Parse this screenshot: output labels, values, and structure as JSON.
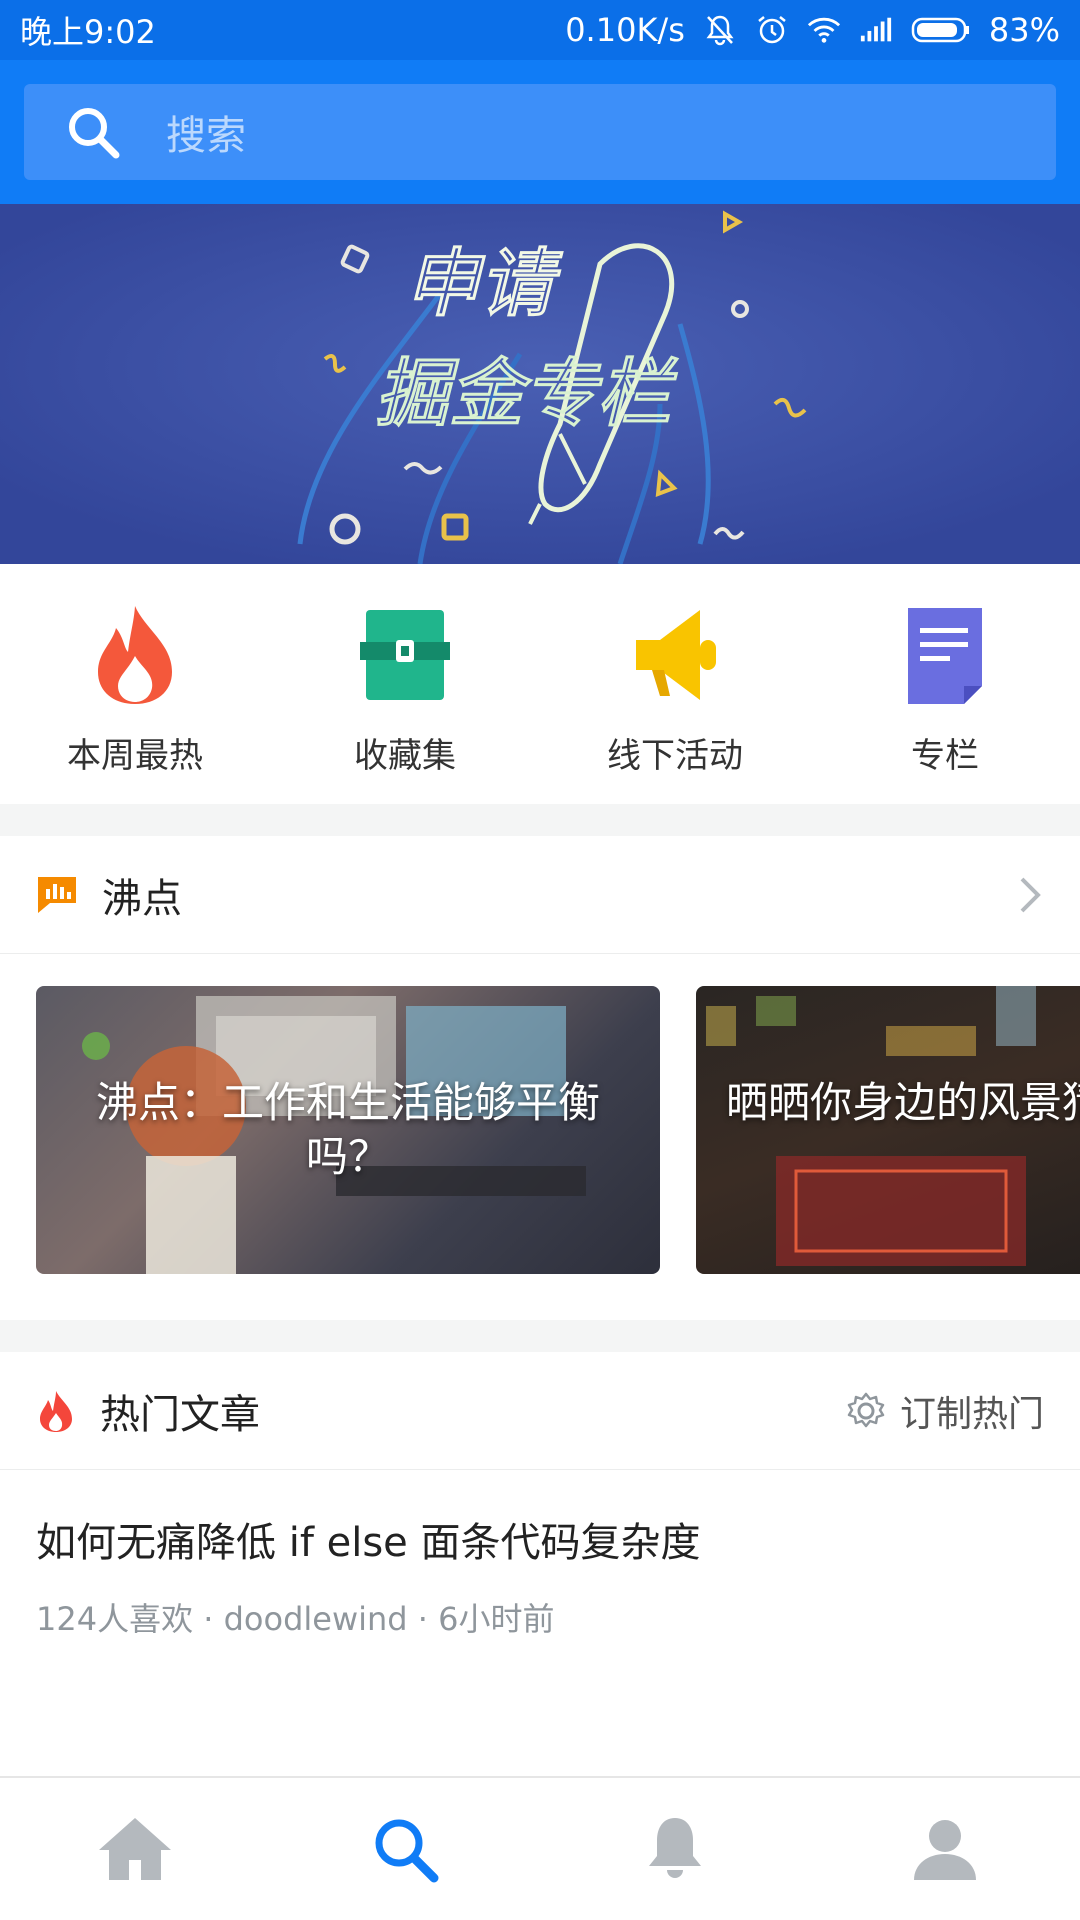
{
  "status_bar": {
    "time": "晚上9:02",
    "speed": "0.10K/s",
    "battery": "83%",
    "icons": [
      "mute-icon",
      "alarm-icon",
      "wifi-icon",
      "signal-icon",
      "battery-icon"
    ]
  },
  "search": {
    "placeholder": "搜索",
    "icon": "search-icon"
  },
  "banner": {
    "text_line1": "申请",
    "text_line2": "掘金专栏"
  },
  "quick_entries": [
    {
      "label": "本周最热",
      "icon": "fire-icon",
      "color": "#f4583b"
    },
    {
      "label": "收藏集",
      "icon": "collection-box-icon",
      "color": "#20b58c"
    },
    {
      "label": "线下活动",
      "icon": "megaphone-icon",
      "color": "#f9c400"
    },
    {
      "label": "专栏",
      "icon": "document-icon",
      "color": "#6a6ee0"
    }
  ],
  "boiling": {
    "title": "沸点",
    "items": [
      {
        "title": "沸点：工作和生活能够平衡吗？"
      },
      {
        "title": "晒晒你身边的风景猜坐标"
      }
    ]
  },
  "hot_articles": {
    "title": "热门文章",
    "customize_label": "订制热门",
    "items": [
      {
        "title": "如何无痛降低 if else 面条代码复杂度",
        "meta": "124人喜欢 · doodlewind · 6小时前"
      }
    ]
  },
  "bottom_nav": [
    "home-icon",
    "search-icon",
    "bell-icon",
    "profile-icon"
  ],
  "colors": {
    "brand_blue": "#107cf6",
    "status_blue": "#0b6fe8",
    "active_nav": "#107cf6",
    "inactive_nav": "#b4b9be"
  }
}
